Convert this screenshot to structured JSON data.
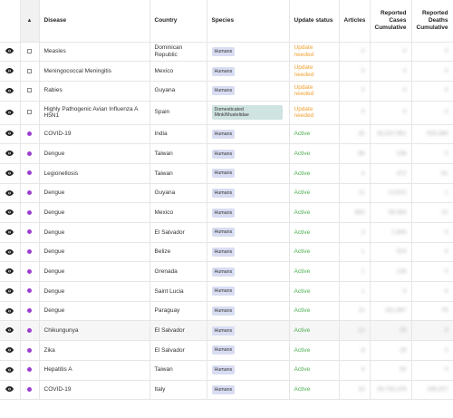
{
  "header": {
    "disease": "Disease",
    "country": "Country",
    "species": "Species",
    "update_status": "Update status",
    "articles": "Articles",
    "cases": "Reported Cases Cumulative",
    "deaths": "Reported Deaths Cumulative",
    "sort_glyph": "▲"
  },
  "rows": [
    {
      "disease": "Measles",
      "country": "Dominican Republic",
      "species": "Humans",
      "status": "Update needed",
      "articles": "0",
      "cases": "0",
      "deaths": "0"
    },
    {
      "disease": "Meningococcal Meningitis",
      "country": "Mexico",
      "species": "Humans",
      "status": "Update needed",
      "articles": "0",
      "cases": "0",
      "deaths": "0"
    },
    {
      "disease": "Rabies",
      "country": "Guyana",
      "species": "Humans",
      "status": "Update needed",
      "articles": "0",
      "cases": "0",
      "deaths": "0"
    },
    {
      "disease": "Highly Pathogenic Avian Influenza A H5N1",
      "country": "Spain",
      "species": "Domesticated Mink/Mustelidae",
      "status": "Update needed",
      "articles": "0",
      "cases": "0",
      "deaths": "0"
    },
    {
      "disease": "COVID-19",
      "country": "India",
      "species": "Humans",
      "status": "Active",
      "articles": "25",
      "cases": "45,037,961",
      "deaths": "533,389"
    },
    {
      "disease": "Dengue",
      "country": "Taiwan",
      "species": "Humans",
      "status": "Active",
      "articles": "86",
      "cases": "239",
      "deaths": "0"
    },
    {
      "disease": "Legionellosis",
      "country": "Taiwan",
      "species": "Humans",
      "status": "Active",
      "articles": "4",
      "cases": "472",
      "deaths": "81"
    },
    {
      "disease": "Dengue",
      "country": "Guyana",
      "species": "Humans",
      "status": "Active",
      "articles": "11",
      "cases": "13,813",
      "deaths": "1"
    },
    {
      "disease": "Dengue",
      "country": "Mexico",
      "species": "Humans",
      "status": "Active",
      "articles": "863",
      "cases": "59,393",
      "deaths": "22"
    },
    {
      "disease": "Dengue",
      "country": "El Salvador",
      "species": "Humans",
      "status": "Active",
      "articles": "3",
      "cases": "1,809",
      "deaths": "0"
    },
    {
      "disease": "Dengue",
      "country": "Belize",
      "species": "Humans",
      "status": "Active",
      "articles": "1",
      "cases": "524",
      "deaths": "0"
    },
    {
      "disease": "Dengue",
      "country": "Grenada",
      "species": "Humans",
      "status": "Active",
      "articles": "1",
      "cases": "126",
      "deaths": "0"
    },
    {
      "disease": "Dengue",
      "country": "Saint Lucia",
      "species": "Humans",
      "status": "Active",
      "articles": "1",
      "cases": "5",
      "deaths": "0"
    },
    {
      "disease": "Dengue",
      "country": "Paraguay",
      "species": "Humans",
      "status": "Active",
      "articles": "11",
      "cases": "251,967",
      "deaths": "76"
    },
    {
      "disease": "Chikungunya",
      "country": "El Salvador",
      "species": "Humans",
      "status": "Active",
      "articles": "12",
      "cases": "29",
      "deaths": "0"
    },
    {
      "disease": "Zika",
      "country": "El Salvador",
      "species": "Humans",
      "status": "Active",
      "articles": "8",
      "cases": "29",
      "deaths": "0"
    },
    {
      "disease": "Hepatitis A",
      "country": "Taiwan",
      "species": "Humans",
      "status": "Active",
      "articles": "4",
      "cases": "92",
      "deaths": "0"
    },
    {
      "disease": "COVID-19",
      "country": "Italy",
      "species": "Humans",
      "status": "Active",
      "articles": "15",
      "cases": "26,735,379",
      "deaths": "196,027"
    }
  ],
  "colors": {
    "update_needed": "#f0a030",
    "active": "#4caf50",
    "active_marker": "#9b3fcf",
    "species_tag": "#d9ddf2"
  }
}
